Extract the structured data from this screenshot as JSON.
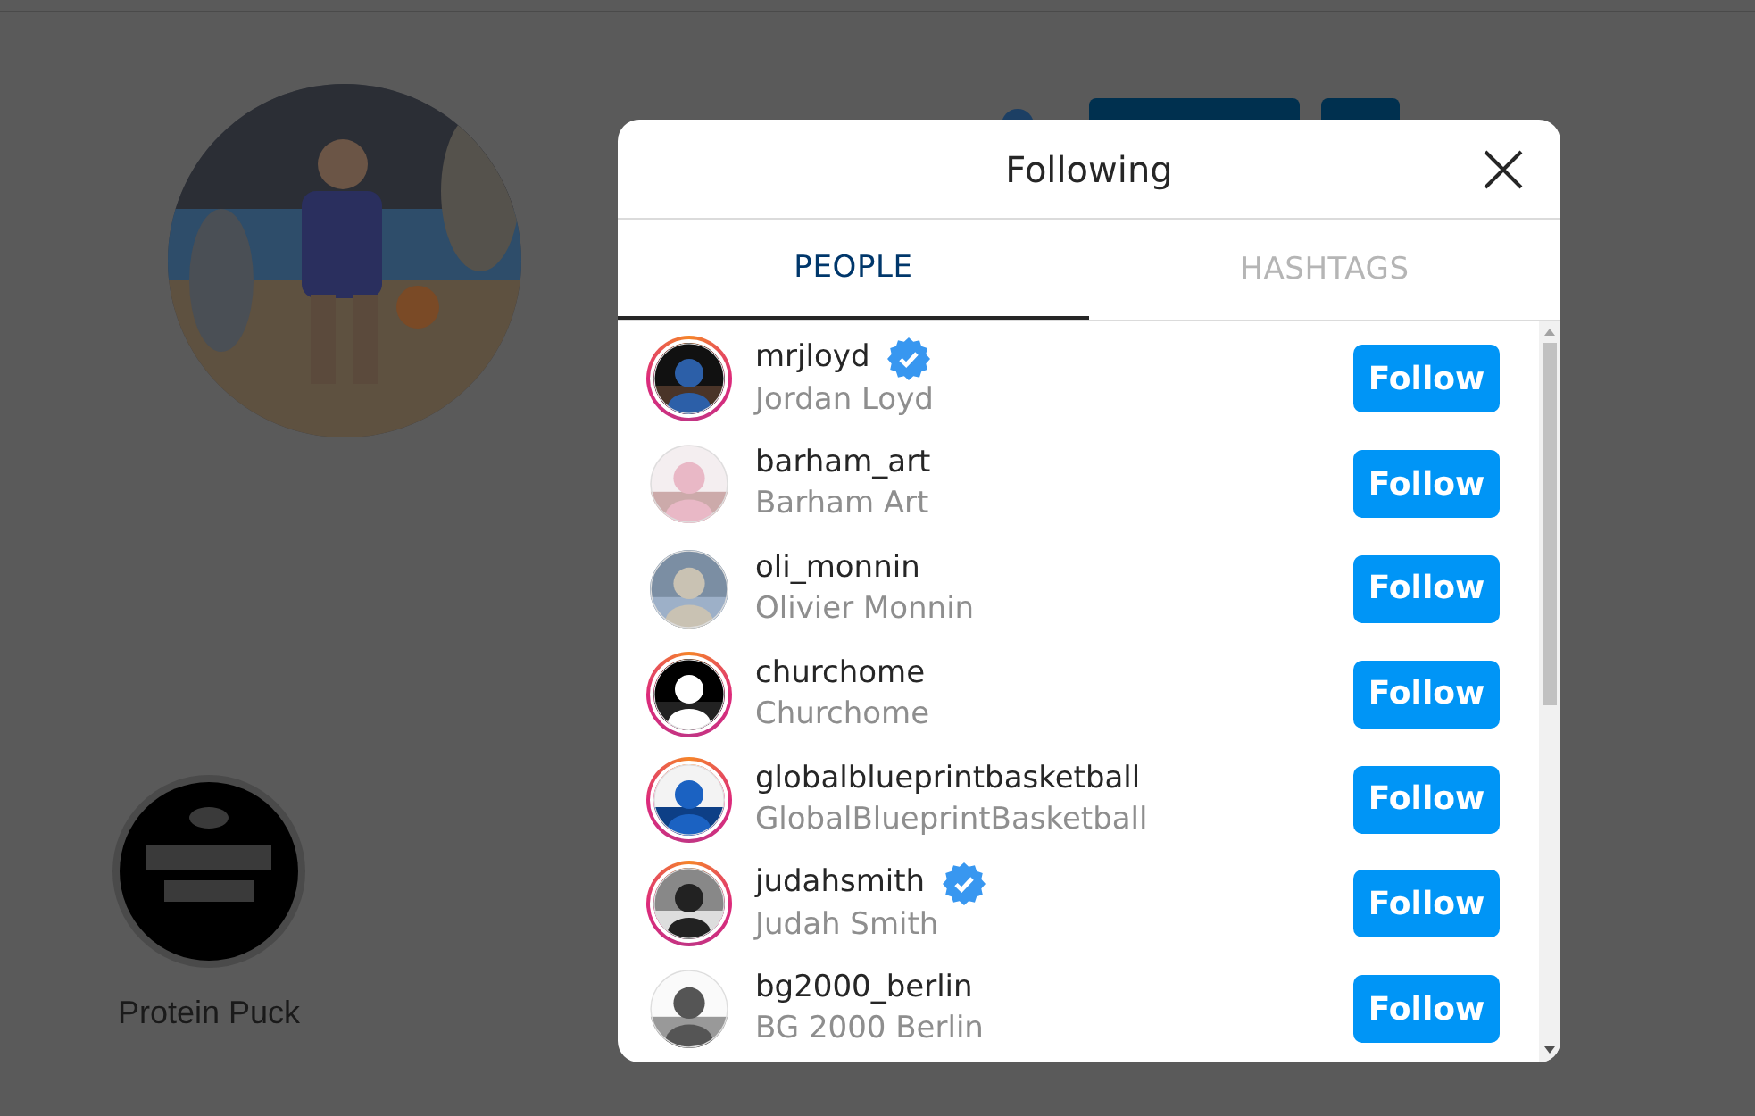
{
  "profile": {
    "highlights": [
      {
        "label": "Protein Puck"
      }
    ]
  },
  "dialog": {
    "title": "Following",
    "tabs": [
      {
        "label": "PEOPLE",
        "selected": true
      },
      {
        "label": "HASHTAGS",
        "selected": false
      }
    ],
    "accounts": [
      {
        "username": "mrjloyd",
        "full_name": "Jordan Loyd",
        "verified": true,
        "story_ring": true,
        "button": "Follow"
      },
      {
        "username": "barham_art",
        "full_name": "Barham Art",
        "verified": false,
        "story_ring": false,
        "button": "Follow"
      },
      {
        "username": "oli_monnin",
        "full_name": "Olivier Monnin",
        "verified": false,
        "story_ring": false,
        "button": "Follow"
      },
      {
        "username": "churchome",
        "full_name": "Churchome",
        "verified": false,
        "story_ring": true,
        "button": "Follow"
      },
      {
        "username": "globalblueprintbasketball",
        "full_name": "GlobalBlueprintBasketball",
        "verified": false,
        "story_ring": true,
        "button": "Follow"
      },
      {
        "username": "judahsmith",
        "full_name": "Judah Smith",
        "verified": true,
        "story_ring": true,
        "button": "Follow"
      },
      {
        "username": "bg2000_berlin",
        "full_name": "BG 2000 Berlin",
        "verified": false,
        "story_ring": false,
        "button": "Follow"
      }
    ]
  }
}
